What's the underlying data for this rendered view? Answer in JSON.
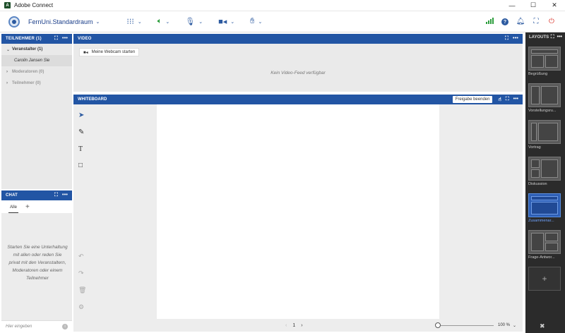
{
  "window": {
    "title": "Adobe Connect",
    "minimize": "—",
    "maximize": "☐",
    "close": "✕"
  },
  "topbar": {
    "room_name": "FernUni.Standardraum"
  },
  "participants": {
    "title": "TEILNEHMER (1)",
    "groups": [
      {
        "label": "Veranstalter (1)",
        "expanded": true
      },
      {
        "label": "Moderatoren (0)",
        "expanded": false
      },
      {
        "label": "Teilnehmer (0)",
        "expanded": false
      }
    ],
    "user": "Carolin Jansen Sie"
  },
  "chat": {
    "title": "CHAT",
    "tab": "Alle",
    "add": "+",
    "empty_message": "Starten Sie eine Unterhaltung mit allen oder reden Sie privat mit den Veranstaltern, Moderatoren oder einem Teilnehmer",
    "input_placeholder": "Hier eingeben"
  },
  "video": {
    "title": "VIDEO",
    "start_cam": "Meine Webcam starten",
    "no_feed": "Kein Video-Feed verfügbar"
  },
  "whiteboard": {
    "title": "WHITEBOARD",
    "stop_share": "Freigabe beenden",
    "page": "1",
    "zoom_label": "100 %",
    "zoom_level_percent": 100
  },
  "layouts": {
    "title": "LAYOUTS",
    "items": [
      {
        "label": "Begrüßung"
      },
      {
        "label": "Vorstellungsru..."
      },
      {
        "label": "Vortrag"
      },
      {
        "label": "Diskussion"
      },
      {
        "label": "Zusammenar..."
      },
      {
        "label": "Frage-Antwor..."
      }
    ],
    "active_index": 4,
    "add": "+"
  },
  "colors": {
    "header_blue": "#2255a4",
    "accent_blue": "#2c5aa0",
    "green": "#2e9e3e",
    "red": "#d9342b"
  }
}
